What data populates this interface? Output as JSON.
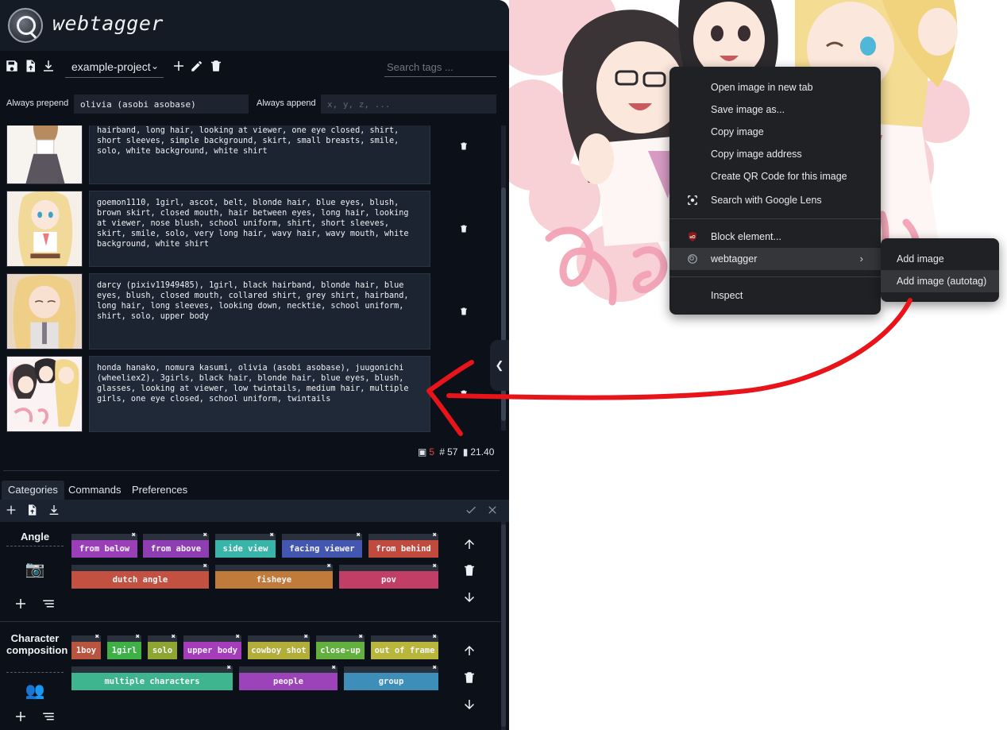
{
  "app": {
    "title": "webtagger"
  },
  "toolbar": {
    "project_name": "example-project",
    "search_placeholder": "Search tags ..."
  },
  "prepend": {
    "prepend_label": "Always prepend",
    "prepend_value": "olivia (asobi asobase)",
    "append_label": "Always append",
    "append_placeholder": "x, y, z, ..."
  },
  "images": [
    {
      "tags": "blush, breasts, brown skirt, closed mouth, collared shirt, hairband, long hair, looking at viewer, one eye closed, shirt, short sleeves, simple background, skirt, small breasts, smile, solo, white background, white shirt"
    },
    {
      "tags": "goemon1110, 1girl, ascot, belt, blonde hair, blue eyes, blush, brown skirt, closed mouth, hair between eyes, long hair, looking at viewer, nose blush, school uniform, shirt, short sleeves, skirt, smile, solo, very long hair, wavy hair, wavy mouth, white background, white shirt"
    },
    {
      "tags": "darcy (pixiv11949485), 1girl, black hairband, blonde hair, blue eyes, blush, closed mouth, collared shirt, grey shirt, hairband, long hair, long sleeves, looking down, necktie, school uniform, shirt, solo, upper body"
    },
    {
      "tags": "honda hanako, nomura kasumi, olivia (asobi asobase), juugonichi (wheeliex2), 3girls, black hair, blonde hair, blue eyes, blush, glasses, looking at viewer, low twintails, medium hair, multiple girls, one eye closed, school uniform, twintails"
    }
  ],
  "stats": {
    "images": "5",
    "tags": "57",
    "tokens": "21.40"
  },
  "tabs": {
    "categories": "Categories",
    "commands": "Commands",
    "preferences": "Preferences"
  },
  "categories": [
    {
      "name": "Angle",
      "emoji": "📷",
      "tags": [
        {
          "label": "from below",
          "color": "#9b3fb8"
        },
        {
          "label": "from above",
          "color": "#8e3eb2"
        },
        {
          "label": "side view",
          "color": "#38b4a8"
        },
        {
          "label": "facing viewer",
          "color": "#4457b0"
        },
        {
          "label": "from behind",
          "color": "#c14a3e"
        },
        {
          "label": "dutch angle",
          "color": "#c25141"
        },
        {
          "label": "fisheye",
          "color": "#c07a3a"
        },
        {
          "label": "pov",
          "color": "#c13e67"
        }
      ]
    },
    {
      "name": "Character composition",
      "emoji": "👥",
      "tags": [
        {
          "label": "1boy",
          "color": "#b9543f"
        },
        {
          "label": "1girl",
          "color": "#3db046"
        },
        {
          "label": "solo",
          "color": "#8ea532"
        },
        {
          "label": "upper body",
          "color": "#a53dbb"
        },
        {
          "label": "cowboy shot",
          "color": "#b3ad3a"
        },
        {
          "label": "close-up",
          "color": "#63b03e"
        },
        {
          "label": "out of frame",
          "color": "#b8b63b"
        },
        {
          "label": "multiple characters",
          "color": "#3fb58f"
        },
        {
          "label": "people",
          "color": "#9c43b9"
        },
        {
          "label": "group",
          "color": "#3d8fba"
        }
      ]
    }
  ],
  "context_menu": {
    "open_new_tab": "Open image in new tab",
    "save_as": "Save image as...",
    "copy_image": "Copy image",
    "copy_address": "Copy image address",
    "qr_code": "Create QR Code for this image",
    "google_lens": "Search with Google Lens",
    "block_element": "Block element...",
    "webtagger": "webtagger",
    "inspect": "Inspect"
  },
  "submenu": {
    "add_image": "Add image",
    "add_image_autotag": "Add image (autotag)"
  },
  "colors": {
    "panel_bg": "#0c1119",
    "header_bg": "#151b25",
    "menu_bg": "#202124",
    "annotation_red": "#e8141a",
    "stat_red": "#e2483d"
  }
}
